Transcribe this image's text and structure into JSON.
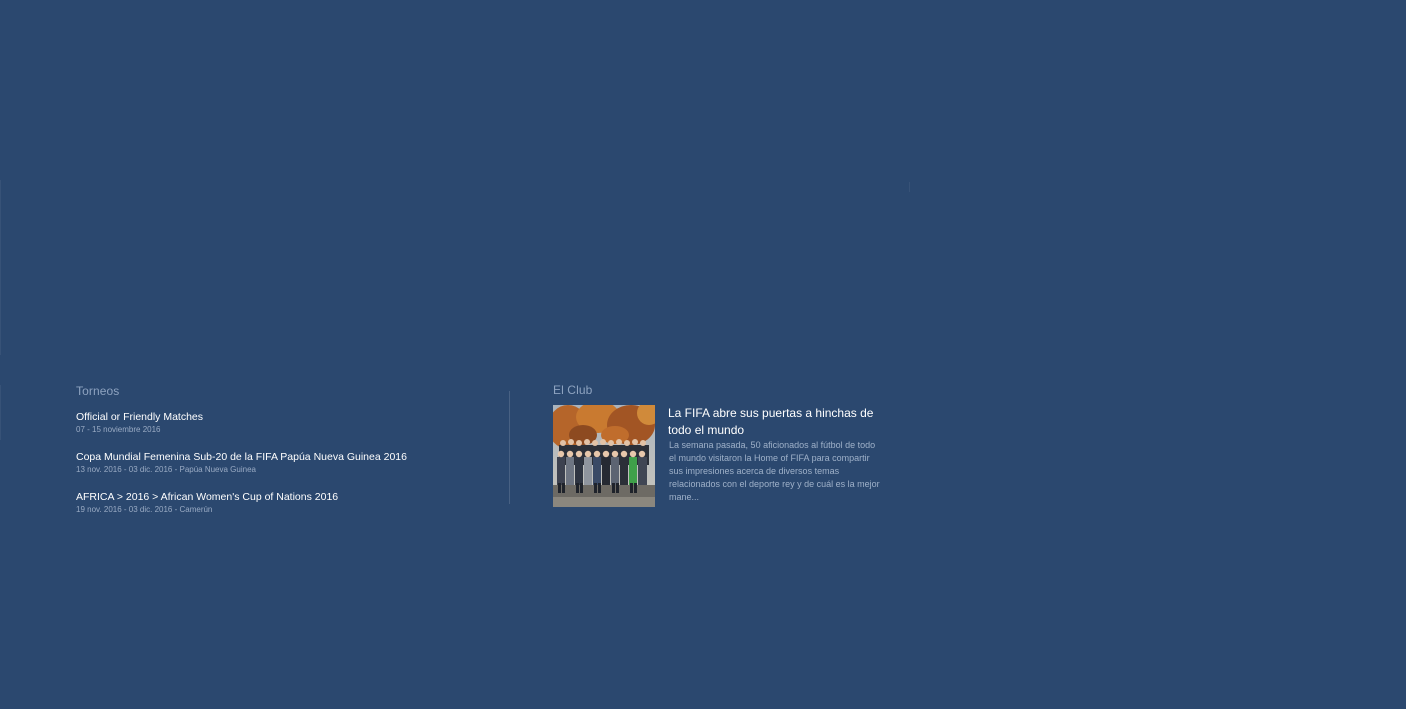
{
  "tournaments": {
    "title": "Torneos",
    "items": [
      {
        "name": "Official or Friendly Matches",
        "meta": "07 - 15 noviembre 2016"
      },
      {
        "name": "Copa Mundial Femenina Sub-20 de la FIFA Papúa Nueva Guinea 2016",
        "meta": "13 nov. 2016 - 03 dic. 2016 - Papúa Nueva Guinea"
      },
      {
        "name": "AFRICA > 2016 > African Women's Cup of Nations 2016",
        "meta": "19 nov. 2016 - 03 dic. 2016 - Camerún"
      }
    ]
  },
  "club": {
    "title": "El Club",
    "headline": "La FIFA abre sus puertas a hinchas de todo el mundo",
    "excerpt": "La semana pasada, 50 aficionados al fútbol de todo el mundo visitaron la Home of FIFA para compartir sus impresiones acerca de diversos temas relacionados con el deporte rey y de cuál es la mejor mane..."
  },
  "colors": {
    "background": "#2b486f",
    "title": "#8ea3c0",
    "text": "#ffffff",
    "meta": "#9aabc4"
  }
}
